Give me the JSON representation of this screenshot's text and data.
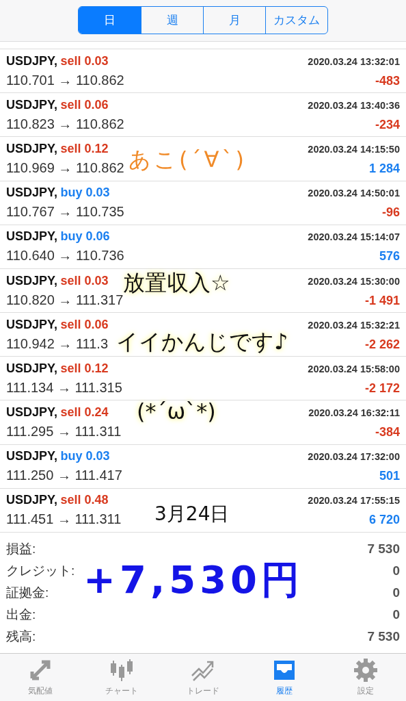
{
  "period_tabs": [
    {
      "label": "日",
      "selected": true
    },
    {
      "label": "週",
      "selected": false
    },
    {
      "label": "月",
      "selected": false
    },
    {
      "label": "カスタム",
      "selected": false
    }
  ],
  "deals": [
    {
      "symbol": "USDJPY,",
      "volume": {
        "text": "sell 0.03",
        "color": "#d83a1f"
      },
      "prices": "110.701 → 110.862",
      "time": "2020.03.24 13:32:01",
      "profit": {
        "text": "-483",
        "color": "#d83a1f"
      }
    },
    {
      "symbol": "USDJPY,",
      "volume": {
        "text": "sell 0.06",
        "color": "#d83a1f"
      },
      "prices": "110.823 → 110.862",
      "time": "2020.03.24 13:40:36",
      "profit": {
        "text": "-234",
        "color": "#d83a1f"
      }
    },
    {
      "symbol": "USDJPY,",
      "volume": {
        "text": "sell 0.12",
        "color": "#d83a1f"
      },
      "prices": "110.969 → 110.862",
      "time": "2020.03.24 14:15:50",
      "profit": {
        "text": "1 284",
        "color": "#1a7ff0"
      }
    },
    {
      "symbol": "USDJPY,",
      "volume": {
        "text": "buy 0.03",
        "color": "#1a7ff0"
      },
      "prices": "110.767 → 110.735",
      "time": "2020.03.24 14:50:01",
      "profit": {
        "text": "-96",
        "color": "#d83a1f"
      }
    },
    {
      "symbol": "USDJPY,",
      "volume": {
        "text": "buy 0.06",
        "color": "#1a7ff0"
      },
      "prices": "110.640 → 110.736",
      "time": "2020.03.24 15:14:07",
      "profit": {
        "text": "576",
        "color": "#1a7ff0"
      }
    },
    {
      "symbol": "USDJPY,",
      "volume": {
        "text": "sell 0.03",
        "color": "#d83a1f"
      },
      "prices": "110.820 → 111.317",
      "time": "2020.03.24 15:30:00",
      "profit": {
        "text": "-1 491",
        "color": "#d83a1f"
      }
    },
    {
      "symbol": "USDJPY,",
      "volume": {
        "text": "sell 0.06",
        "color": "#d83a1f"
      },
      "prices": "110.942 → 111.3",
      "time": "2020.03.24 15:32:21",
      "profit": {
        "text": "-2 262",
        "color": "#d83a1f"
      }
    },
    {
      "symbol": "USDJPY,",
      "volume": {
        "text": "sell 0.12",
        "color": "#d83a1f"
      },
      "prices": "111.134 → 111.315",
      "time": "2020.03.24 15:58:00",
      "profit": {
        "text": "-2 172",
        "color": "#d83a1f"
      }
    },
    {
      "symbol": "USDJPY,",
      "volume": {
        "text": "sell 0.24",
        "color": "#d83a1f"
      },
      "prices": "111.295 → 111.311",
      "time": "2020.03.24 16:32:11",
      "profit": {
        "text": "-384",
        "color": "#d83a1f"
      }
    },
    {
      "symbol": "USDJPY,",
      "volume": {
        "text": "buy 0.03",
        "color": "#1a7ff0"
      },
      "prices": "111.250 → 111.417",
      "time": "2020.03.24 17:32:00",
      "profit": {
        "text": "501",
        "color": "#1a7ff0"
      }
    },
    {
      "symbol": "USDJPY,",
      "volume": {
        "text": "sell 0.48",
        "color": "#d83a1f"
      },
      "prices": "111.451 → 111.311",
      "time": "2020.03.24 17:55:15",
      "profit": {
        "text": "6 720",
        "color": "#1a7ff0"
      }
    }
  ],
  "summary": [
    {
      "label": "損益:",
      "value": "7 530"
    },
    {
      "label": "クレジット:",
      "value": "0"
    },
    {
      "label": "証拠金:",
      "value": "0"
    },
    {
      "label": "出金:",
      "value": "0"
    },
    {
      "label": "残高:",
      "value": "7 530"
    }
  ],
  "handwriting": [
    {
      "text": "あこ(´∀`)",
      "kind": "orange"
    },
    {
      "text": "放置収入☆",
      "kind": "marker"
    },
    {
      "text": "イイかんじです♪",
      "kind": "marker"
    },
    {
      "text": "(*´ω`*)",
      "kind": "marker"
    },
    {
      "text": "3月24日",
      "kind": "pen"
    },
    {
      "text": "+7,530円",
      "kind": "blue"
    }
  ],
  "bottom_tabs": [
    {
      "label": "気配値",
      "selected": false
    },
    {
      "label": "チャート",
      "selected": false
    },
    {
      "label": "トレード",
      "selected": false
    },
    {
      "label": "履歴",
      "selected": true
    },
    {
      "label": "設定",
      "selected": false
    }
  ]
}
